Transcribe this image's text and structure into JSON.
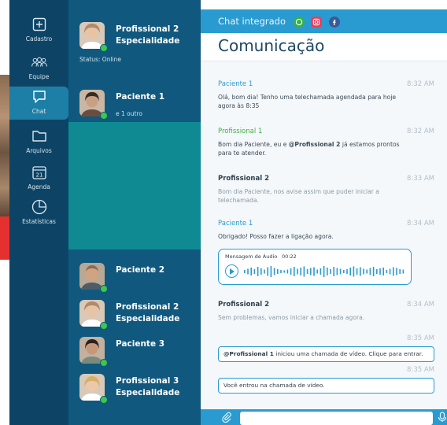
{
  "nav": {
    "items": [
      {
        "label": "Cadastro",
        "icon": "plus-square-icon"
      },
      {
        "label": "Equipe",
        "icon": "team-icon"
      },
      {
        "label": "Chat",
        "icon": "chat-icon"
      },
      {
        "label": "Arquivos",
        "icon": "folder-icon"
      },
      {
        "label": "Agenda",
        "icon": "calendar-icon",
        "day": "21"
      },
      {
        "label": "Estatísticas",
        "icon": "pie-chart-icon"
      }
    ]
  },
  "profile": {
    "name_line1": "Profissional 2",
    "name_line2": "Especialidade",
    "status": "Status: Online"
  },
  "contacts": [
    {
      "name": "Paciente 1",
      "sub": "e 1 outro"
    },
    {
      "name": "Paciente 2"
    },
    {
      "name_line1": "Profissional 2",
      "name_line2": "Especialidade"
    },
    {
      "name": "Paciente 3"
    },
    {
      "name_line1": "Profissional 3",
      "name_line2": "Especialidade"
    }
  ],
  "chat": {
    "header_title": "Chat integrado",
    "page_title": "Comunicação",
    "colors": {
      "accent": "#2a9bd0",
      "green": "#3fae49",
      "nav": "#0d4466",
      "contacts": "#11587e",
      "active": "#0f8a93"
    },
    "messages": [
      {
        "sender": "Paciente 1",
        "time": "8:32 AM",
        "text": "Olá, bom dia! Tenho uma telechamada agendada para hoje agora às 8:35"
      },
      {
        "sender": "Profissional 1",
        "time": "8:32 AM",
        "text_pre": "Bom dia Paciente, eu e ",
        "text_mention": "@Profissional 2",
        "text_post": " já estamos prontos para te atender."
      },
      {
        "sender": "Profissional 2",
        "time": "8:33 AM",
        "text": "Bom dia Paciente, nos avise assim que puder iniciar a telechamada."
      },
      {
        "sender": "Paciente 1",
        "time": "8:34 AM",
        "text": "Obrigado! Posso fazer a ligação agora."
      },
      {
        "sender": "Profissional 2",
        "time": "8:34 AM",
        "text": "Sem problemas, vamos iniciar a chamada agora."
      }
    ],
    "audio": {
      "label": "Mensagem de Áudio",
      "duration": "00:22"
    },
    "system": [
      {
        "time": "8:35 AM",
        "mention": "@Profissional 1",
        "text": " iniciou uma chamada de vídeo. Clique para entrar."
      },
      {
        "time": "8:35 AM",
        "text": "Você entrou na chamada de vídeo."
      }
    ]
  }
}
